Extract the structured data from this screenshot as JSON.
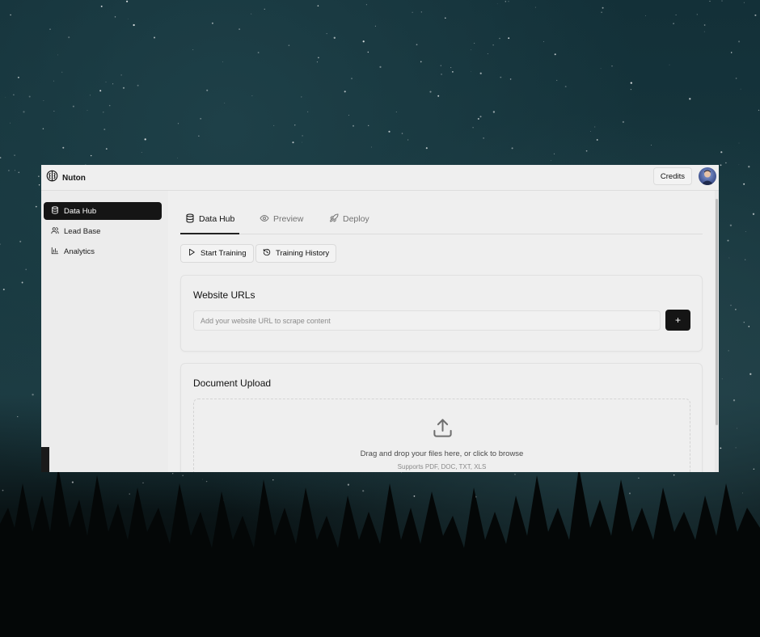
{
  "app": {
    "brand_name": "Nuton",
    "credits_label": "Credits"
  },
  "sidebar": {
    "items": [
      {
        "label": "Data Hub",
        "icon": "database-icon",
        "active": true
      },
      {
        "label": "Lead Base",
        "icon": "users-icon",
        "active": false
      },
      {
        "label": "Analytics",
        "icon": "bar-chart-icon",
        "active": false
      }
    ]
  },
  "tabs": [
    {
      "label": "Data Hub",
      "icon": "database-icon",
      "active": true
    },
    {
      "label": "Preview",
      "icon": "eye-icon",
      "active": false
    },
    {
      "label": "Deploy",
      "icon": "rocket-icon",
      "active": false
    }
  ],
  "actions": {
    "start_training": "Start Training",
    "training_history": "Training History"
  },
  "website_urls": {
    "title": "Website URLs",
    "placeholder": "Add your website URL to scrape content",
    "value": "",
    "add_label": "+"
  },
  "document_upload": {
    "title": "Document Upload",
    "drop_text": "Drag and drop your files here, or click to browse",
    "supported": "Supports PDF, DOC, TXT, XLS"
  },
  "colors": {
    "active_bg": "#151515",
    "panel_bg": "#efefef"
  }
}
